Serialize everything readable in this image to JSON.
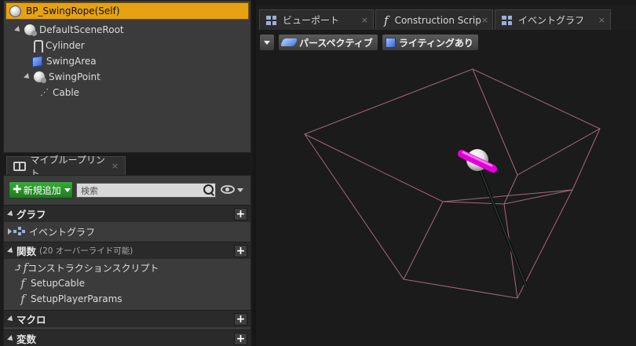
{
  "components": {
    "self_label": "BP_SwingRope(Self)",
    "tree": [
      {
        "label": "DefaultSceneRoot",
        "icon": "scene-root-icon"
      },
      {
        "label": "Cylinder",
        "icon": "cylinder-icon"
      },
      {
        "label": "SwingArea",
        "icon": "box-collision-icon"
      },
      {
        "label": "SwingPoint",
        "icon": "scene-component-icon"
      },
      {
        "label": "Cable",
        "icon": "cable-icon"
      }
    ]
  },
  "my_blueprint": {
    "tab_label": "マイブループリント",
    "tab_close": "×",
    "add_new_label": "新規追加",
    "search_placeholder": "検索",
    "sections": {
      "graphs": {
        "title": "グラフ",
        "items": [
          "イベントグラフ"
        ]
      },
      "functions": {
        "title": "関数",
        "override_note": "(20 オーバーライド可能)",
        "items": [
          "コンストラクションスクリプト",
          "SetupCable",
          "SetupPlayerParams"
        ]
      },
      "macros": {
        "title": "マクロ"
      },
      "variables": {
        "title": "変数"
      }
    }
  },
  "editor_tabs": [
    {
      "label": "ビューポート",
      "close": "×",
      "icon": "viewport-icon"
    },
    {
      "label": "Construction Scrip",
      "close": "×",
      "icon": "function-icon"
    },
    {
      "label": "イベントグラフ",
      "close": "×",
      "icon": "event-graph-icon"
    }
  ],
  "viewport": {
    "perspective_label": "パースペクティブ",
    "lighting_label": "ライティングあり"
  },
  "colors": {
    "self_highlight": "#e6a213",
    "add_button": "#2e8f2e",
    "box_wireframe": "#a06a7a",
    "swing_capsule": "#e100d8"
  }
}
